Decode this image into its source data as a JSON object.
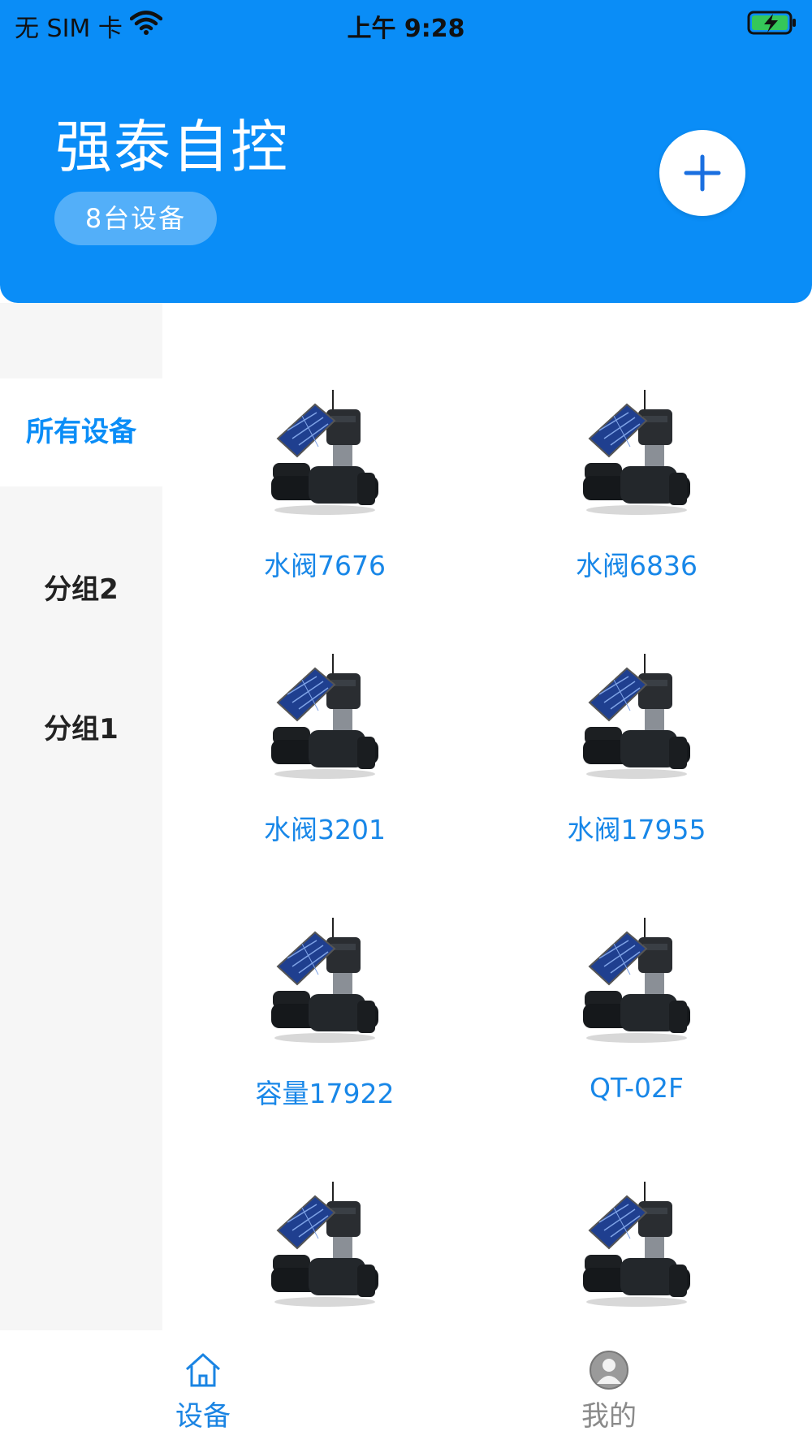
{
  "status_bar": {
    "carrier": "无 SIM 卡",
    "time": "上午 9:28"
  },
  "header": {
    "title": "强泰自控",
    "device_count": "8台设备"
  },
  "sidebar": {
    "items": [
      {
        "label": "所有设备",
        "active": true
      },
      {
        "label": "分组2",
        "active": false
      },
      {
        "label": "分组1",
        "active": false
      }
    ]
  },
  "devices": [
    {
      "name": "水阀7676"
    },
    {
      "name": "水阀6836"
    },
    {
      "name": "水阀3201"
    },
    {
      "name": "水阀17955"
    },
    {
      "name": "容量17922"
    },
    {
      "name": "QT-02F"
    },
    {
      "name": ""
    },
    {
      "name": ""
    }
  ],
  "tabbar": {
    "tabs": [
      {
        "label": "设备",
        "active": true
      },
      {
        "label": "我的",
        "active": false
      }
    ]
  },
  "colors": {
    "header_bg": "#0A8DF7",
    "accent": "#1887E8",
    "sidebar_bg": "#F6F6F6",
    "tab_inactive": "#8A8A8A"
  },
  "icons": {
    "add": "plus-icon",
    "home": "home-icon",
    "me": "user-icon",
    "wifi": "wifi-icon",
    "battery": "battery-charging-icon"
  }
}
